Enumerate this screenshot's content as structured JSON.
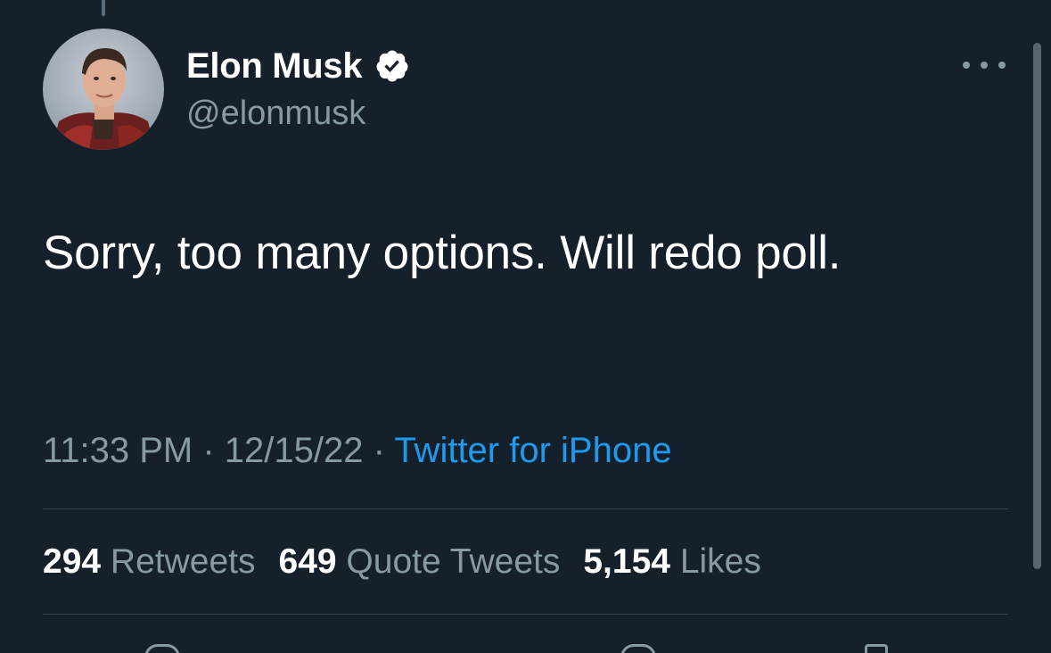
{
  "author": {
    "display_name": "Elon Musk",
    "handle": "@elonmusk",
    "verified": true
  },
  "tweet": {
    "text": "Sorry, too many options. Will redo poll.",
    "time": "11:33 PM",
    "date": "12/15/22",
    "separator": " · ",
    "source": "Twitter for iPhone"
  },
  "stats": {
    "retweets_count": "294",
    "retweets_label": "Retweets",
    "quote_tweets_count": "649",
    "quote_tweets_label": "Quote Tweets",
    "likes_count": "5,154",
    "likes_label": "Likes"
  },
  "icons": {
    "more": "more-horizontal-icon",
    "verified": "verified-badge-icon",
    "reply": "reply-icon",
    "like": "heart-icon",
    "share": "share-icon"
  },
  "colors": {
    "background": "#15202b",
    "primary_text": "#ffffff",
    "secondary_text": "#8899a6",
    "link": "#1d9bf0",
    "divider": "#38444d"
  }
}
